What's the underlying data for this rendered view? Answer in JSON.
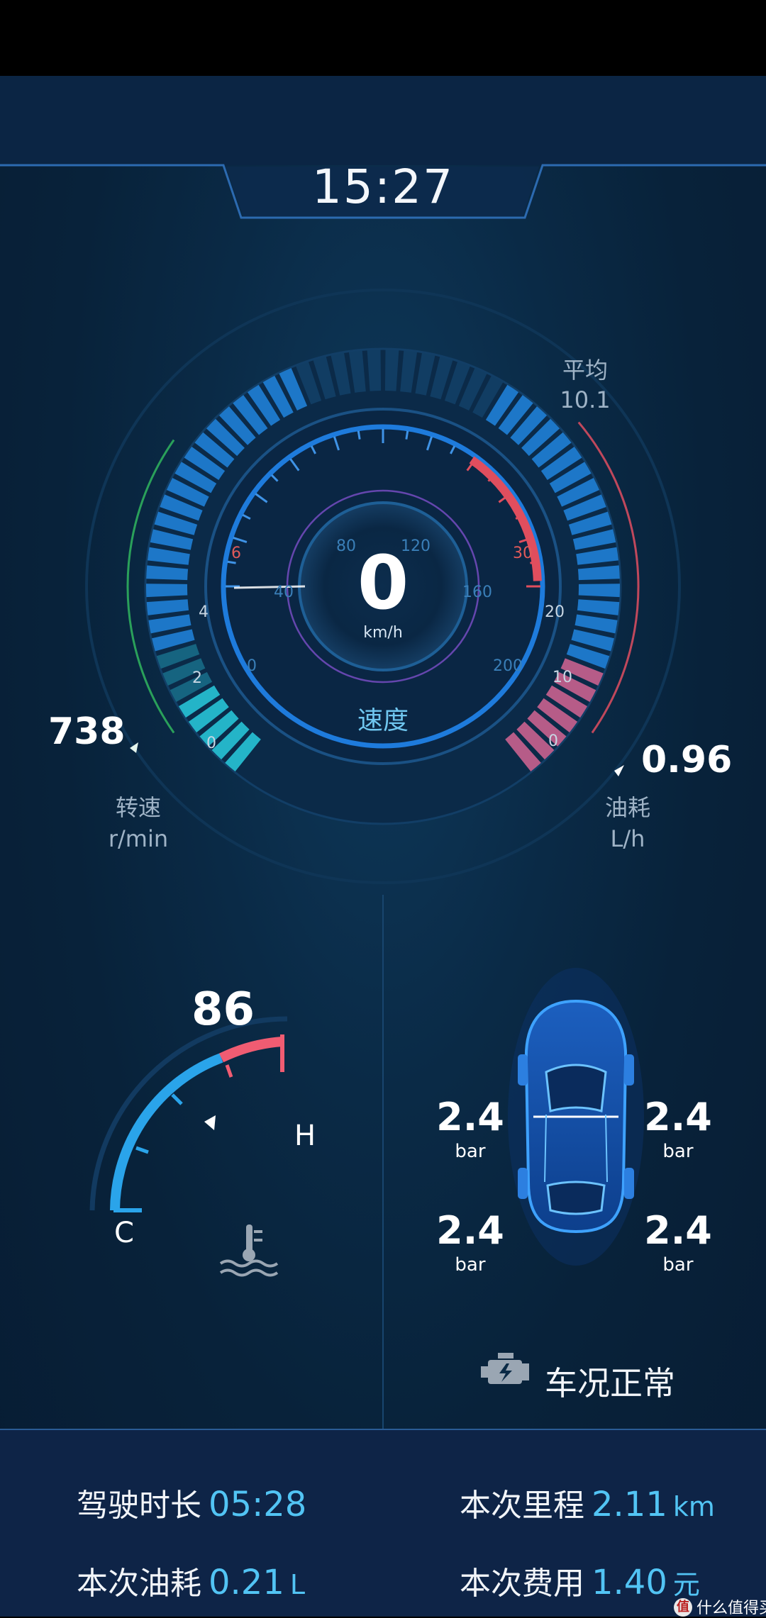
{
  "header": {
    "time": "15:27"
  },
  "rpm": {
    "value": "738",
    "label": "转速",
    "unit": "r/min",
    "scale": [
      "0",
      "2",
      "4",
      "6"
    ],
    "level": 0.12
  },
  "speed": {
    "value": "0",
    "unit": "km/h",
    "label": "速度",
    "scale": [
      "0",
      "40",
      "80",
      "120",
      "160",
      "200"
    ]
  },
  "fuel_rate": {
    "value": "0.96",
    "label": "油耗",
    "unit": "L/h",
    "avg_label": "平均",
    "avg_value": "10.1",
    "scale": [
      "0",
      "10",
      "20",
      "30"
    ]
  },
  "coolant": {
    "value": "86",
    "low_label": "C",
    "high_label": "H",
    "icon": "coolant-temperature-icon"
  },
  "tires": {
    "front_left": {
      "value": "2.4",
      "unit": "bar"
    },
    "front_right": {
      "value": "2.4",
      "unit": "bar"
    },
    "rear_left": {
      "value": "2.4",
      "unit": "bar"
    },
    "rear_right": {
      "value": "2.4",
      "unit": "bar"
    }
  },
  "status": {
    "text": "车况正常",
    "icon": "engine-icon"
  },
  "stats": {
    "drive_time": {
      "label": "驾驶时长",
      "value": "05:28"
    },
    "trip_distance": {
      "label": "本次里程",
      "value": "2.11",
      "unit": "km"
    },
    "trip_fuel": {
      "label": "本次油耗",
      "value": "0.21",
      "unit": "L"
    },
    "trip_cost": {
      "label": "本次费用",
      "value": "1.40",
      "unit": "元"
    }
  },
  "watermark": {
    "text": "值 什么值得买",
    "icon": "smzdm-logo-icon"
  },
  "colors": {
    "accent": "#52c4f4",
    "background": "#08223a",
    "gauge_blue": "#1f7fd6",
    "gauge_cyan": "#27c3d6",
    "gauge_pink": "#d46a9a",
    "warn_red": "#ef5b6f"
  }
}
